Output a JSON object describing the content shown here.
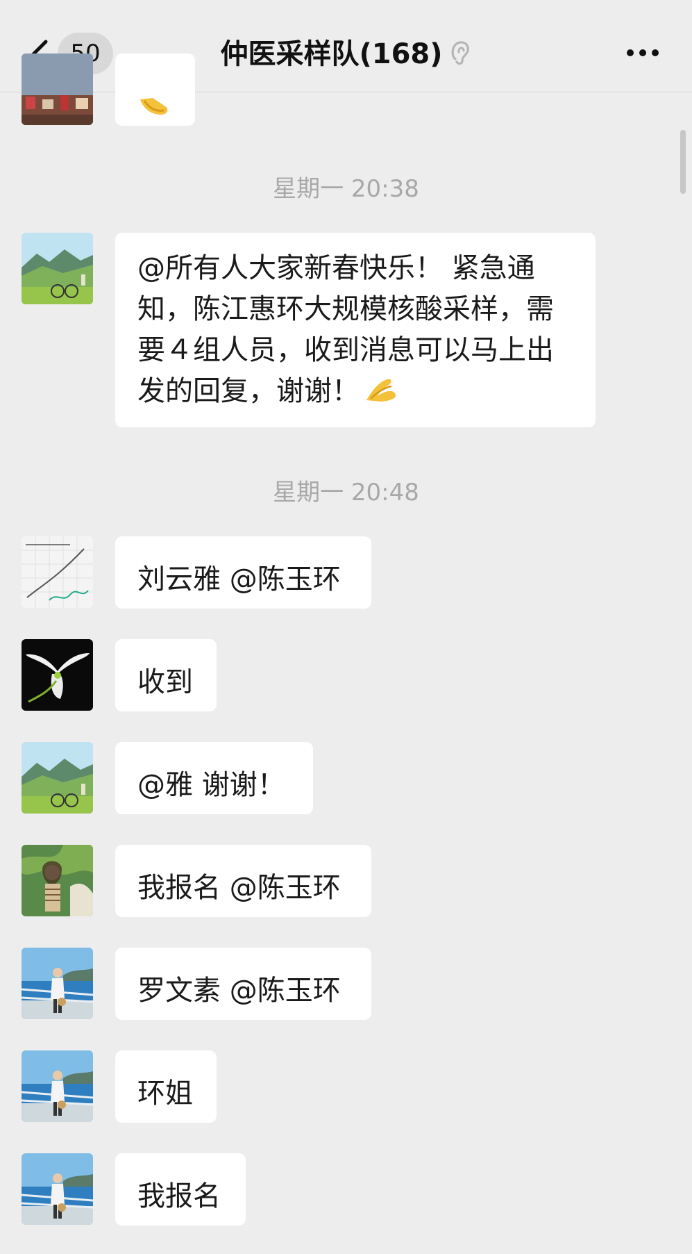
{
  "header": {
    "unread_count": "50",
    "title": "仲医采样队(168)",
    "back_icon": "chevron-left-icon",
    "ear_icon": "ear-icon",
    "more_icon": "more-dots-icon"
  },
  "timestamps": [
    "星期一 20:38",
    "星期一 20:48"
  ],
  "messages": [
    {
      "text": "",
      "avatar": "landscape-avatar",
      "emoji": "clapping-hands-emoji"
    },
    {
      "text": "@所有人大家新春快乐！ 紧急通知，陈江惠环大规模核酸采样，需要４组人员，收到消息可以马上出发的回复，谢谢！",
      "avatar": "green-mountains-avatar",
      "emoji": "ok-hand-emoji"
    },
    {
      "text": "刘云雅 @陈玉环",
      "avatar": "sketch-chart-avatar"
    },
    {
      "text": "收到",
      "avatar": "white-orchid-avatar"
    },
    {
      "text": "@雅 谢谢！",
      "avatar": "green-mountains-avatar"
    },
    {
      "text": "我报名 @陈玉环",
      "avatar": "woman-palm-avatar"
    },
    {
      "text": "罗文素 @陈玉环",
      "avatar": "woman-seaside-avatar"
    },
    {
      "text": "环姐",
      "avatar": "woman-seaside-avatar"
    },
    {
      "text": "我报名",
      "avatar": "woman-seaside-avatar"
    }
  ]
}
